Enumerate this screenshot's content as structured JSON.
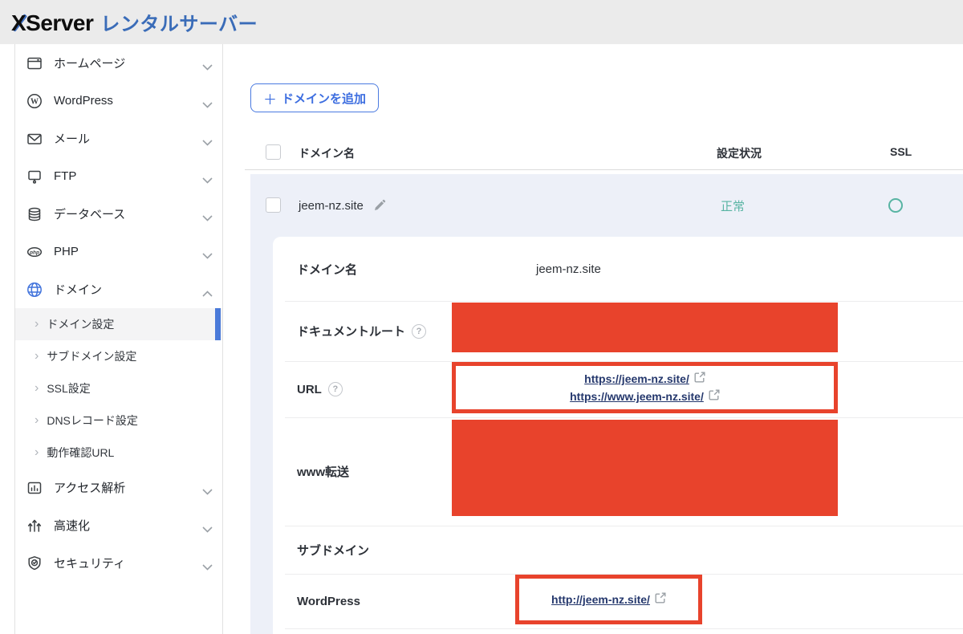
{
  "header": {
    "brand": "XServer",
    "brand_suffix": "レンタルサーバー"
  },
  "sidebar": {
    "items": [
      {
        "label": "ホームページ",
        "icon": "browser-window-icon"
      },
      {
        "label": "WordPress",
        "icon": "wordpress-icon"
      },
      {
        "label": "メール",
        "icon": "mail-icon"
      },
      {
        "label": "FTP",
        "icon": "ftp-monitor-icon"
      },
      {
        "label": "データベース",
        "icon": "database-icon"
      },
      {
        "label": "PHP",
        "icon": "php-icon"
      },
      {
        "label": "ドメイン",
        "icon": "globe-icon",
        "expanded": true
      },
      {
        "label": "アクセス解析",
        "icon": "analytics-icon"
      },
      {
        "label": "高速化",
        "icon": "speed-icon"
      },
      {
        "label": "セキュリティ",
        "icon": "shield-icon"
      }
    ],
    "domain_submenu": [
      {
        "label": "ドメイン設定",
        "active": true
      },
      {
        "label": "サブドメイン設定"
      },
      {
        "label": "SSL設定"
      },
      {
        "label": "DNSレコード設定"
      },
      {
        "label": "動作確認URL"
      }
    ]
  },
  "main": {
    "add_button": {
      "plus": "＋",
      "label": "ドメインを追加"
    },
    "table": {
      "col_domain": "ドメイン名",
      "col_status": "設定状況",
      "col_ssl": "SSL"
    },
    "row": {
      "domain": "jeem-nz.site",
      "status": "正常",
      "ssl": "○"
    },
    "details": {
      "domain_label": "ドメイン名",
      "domain_value": "jeem-nz.site",
      "docroot_label": "ドキュメントルート",
      "url_label": "URL",
      "url_link1": "https://jeem-nz.site/",
      "url_link2": "https://www.jeem-nz.site/",
      "www_label": "www転送",
      "subdomain_label": "サブドメイン",
      "wordpress_label": "WordPress",
      "wordpress_link": "http://jeem-nz.site/"
    }
  },
  "icons": {
    "sub_arrow": "›",
    "help_mark": "?",
    "wp_letter": "W",
    "php_text": "php"
  },
  "colors": {
    "header_bg": "#ebebeb",
    "logo_blue": "#3a6cb8",
    "accent_blue": "#4173dc",
    "active_bar_blue": "#4a7ad9",
    "annotation_red": "#e8432c",
    "status_teal": "#58b4a3",
    "link_navy": "#25386d",
    "row_bg": "#edf0f8"
  }
}
